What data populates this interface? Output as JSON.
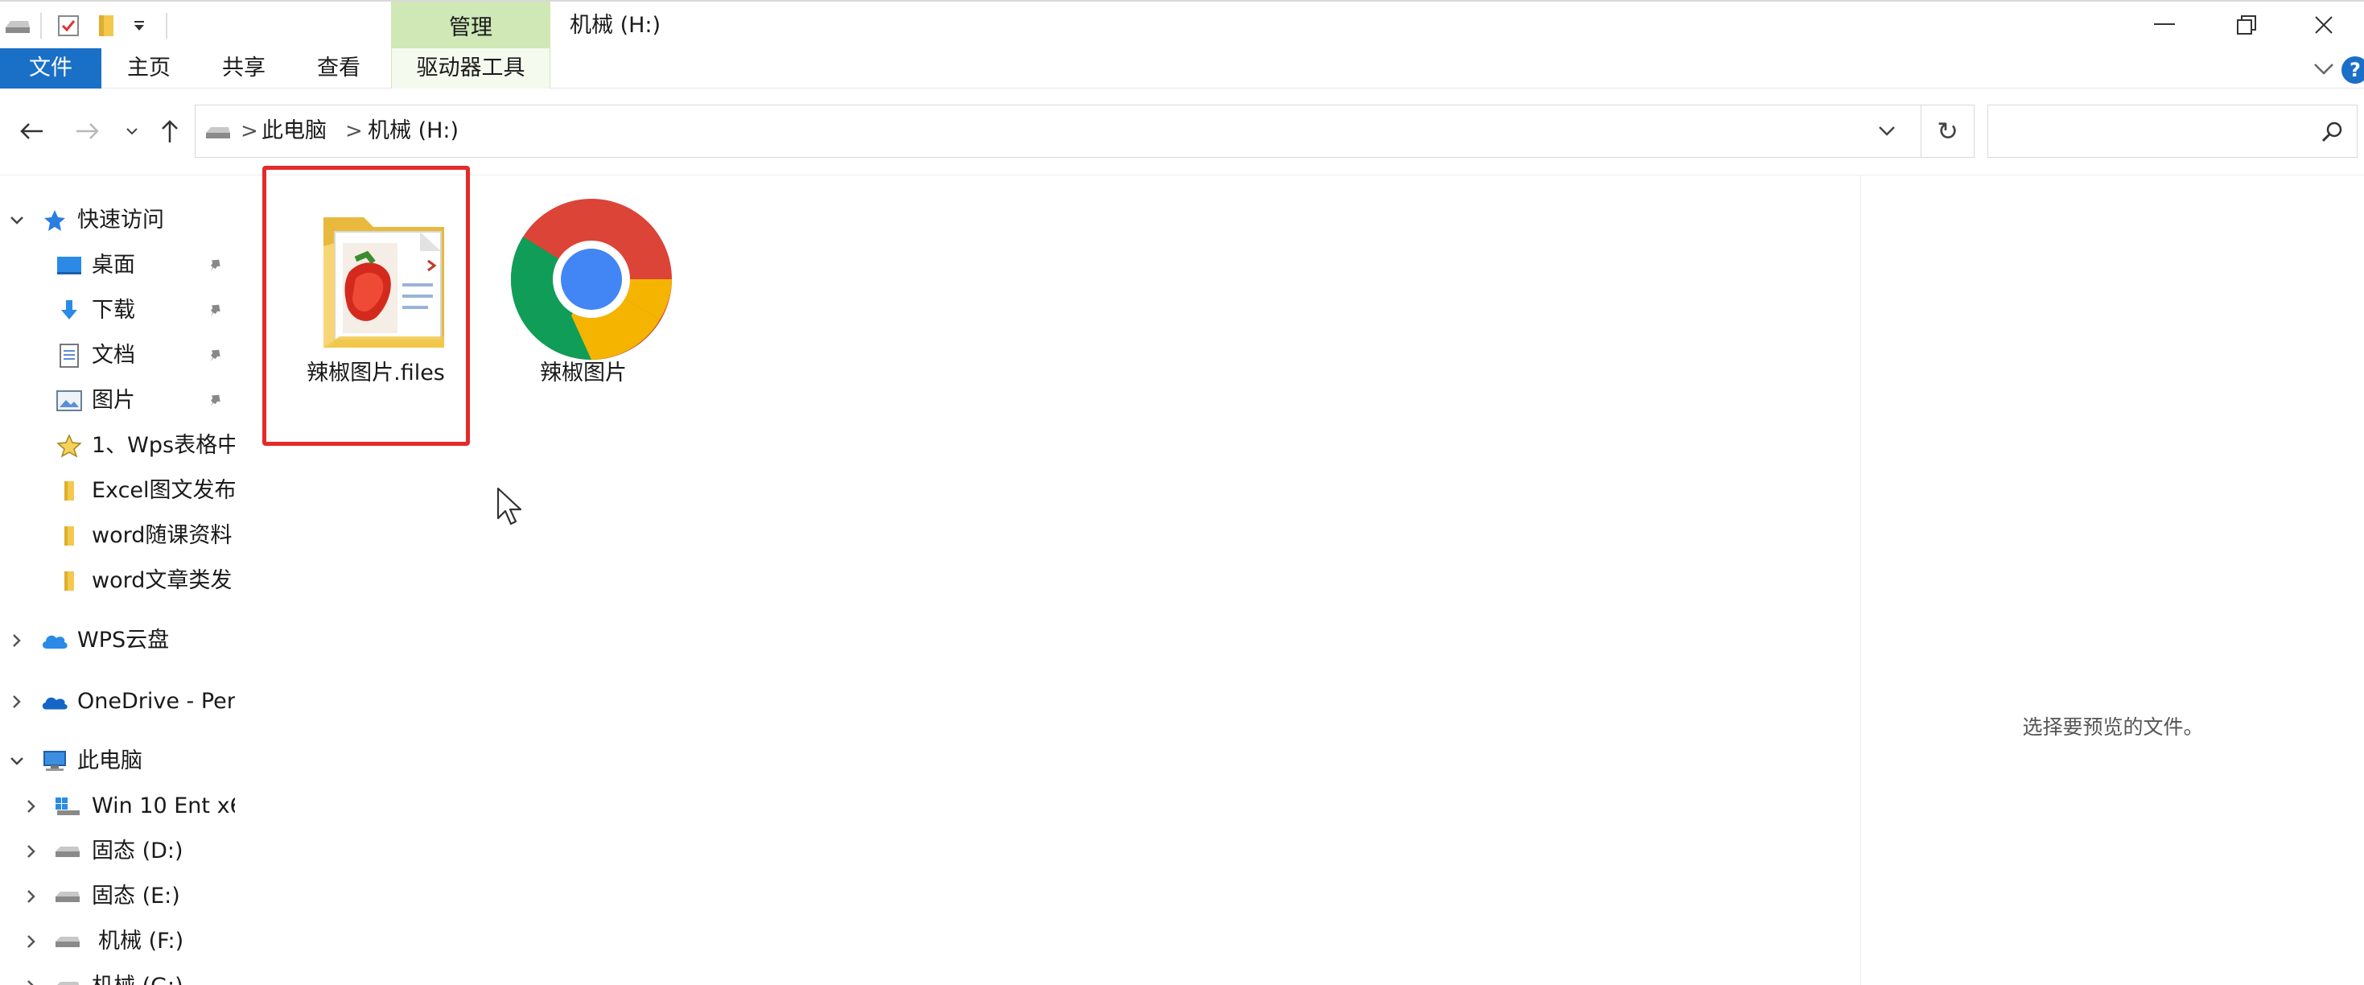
{
  "titlebar": {
    "manage_tab": "管理",
    "window_title": "机械 (H:)"
  },
  "ribbon": {
    "tabs": [
      "文件",
      "主页",
      "共享",
      "查看",
      "驱动器工具"
    ],
    "help": "?"
  },
  "navigation": {
    "back_icon": "arrow-left-icon",
    "forward_icon": "arrow-right-icon",
    "up_icon": "arrow-up-icon",
    "breadcrumb": [
      "此电脑",
      "机械 (H:)"
    ],
    "separator": ">",
    "refresh_icon": "↻",
    "search_placeholder": ""
  },
  "sidebar": {
    "quick_access": "快速访问",
    "pinned": [
      "桌面",
      "下载",
      "文档",
      "图片"
    ],
    "recent": [
      "1、Wps表格中",
      "Excel图文发布",
      "word随课资料",
      "word文章类发"
    ],
    "wps_cloud": "WPS云盘",
    "onedrive": "OneDrive - Per",
    "this_pc": "此电脑",
    "drives": [
      "Win 10 Ent x6",
      "固态 (D:)",
      "固态 (E:)",
      "机械 (F:)",
      "机械 (G:)"
    ]
  },
  "files": [
    {
      "name": "辣椒图片.files",
      "icon": "folder-icon",
      "selected": true
    },
    {
      "name": "辣椒图片",
      "icon": "chrome-icon",
      "selected": false
    }
  ],
  "preview": {
    "empty_text": "选择要预览的文件。"
  },
  "colors": {
    "file_tab": "#1a6fc7",
    "manage_tab": "#cfe8b6",
    "selection_outline": "#e52a2a",
    "folder": "#f2c94c"
  }
}
